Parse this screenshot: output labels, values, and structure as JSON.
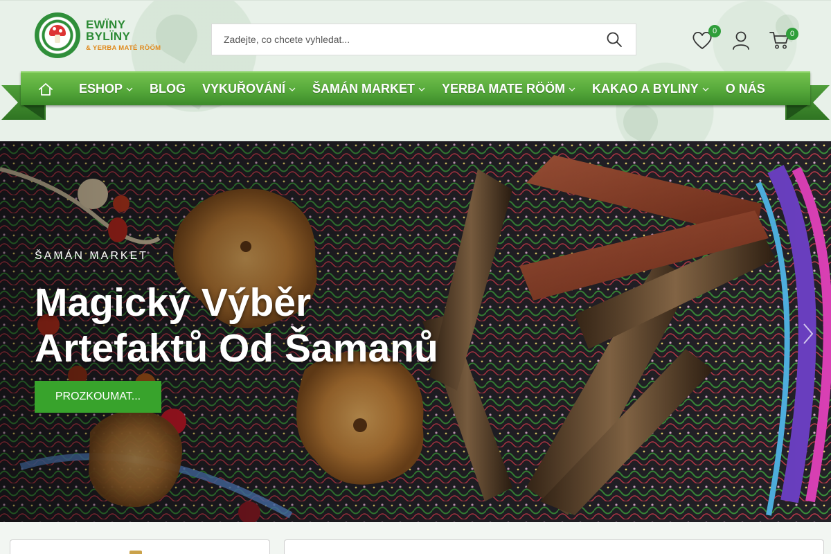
{
  "brand": {
    "name": "EWÏNY BYLÏNY",
    "subtitle": "& YERBA MATÉ RÖÖM"
  },
  "search": {
    "placeholder": "Zadejte, co chcete vyhledat..."
  },
  "header_icons": {
    "wishlist_count": "0",
    "cart_count": "0"
  },
  "nav": {
    "items": [
      {
        "label": "ESHOP",
        "dropdown": true
      },
      {
        "label": "BLOG",
        "dropdown": false
      },
      {
        "label": "VYKUŘOVÁNÍ",
        "dropdown": true
      },
      {
        "label": "ŠAMÁN MARKET",
        "dropdown": true
      },
      {
        "label": "YERBA MATE RÖÖM",
        "dropdown": true
      },
      {
        "label": "KAKAO A BYLINY",
        "dropdown": true
      },
      {
        "label": "O NÁS",
        "dropdown": false
      }
    ]
  },
  "hero": {
    "eyebrow": "ŠAMÁN MARKET",
    "title_line1": "Magický Výběr",
    "title_line2": "Artefaktů Od Šamanů",
    "cta_label": "PROZKOUMAT..."
  },
  "colors": {
    "brand_green": "#38a32c",
    "nav_green": "#55a83a",
    "badge_green": "#2f9e3a",
    "logo_orange": "#e08a1e"
  }
}
